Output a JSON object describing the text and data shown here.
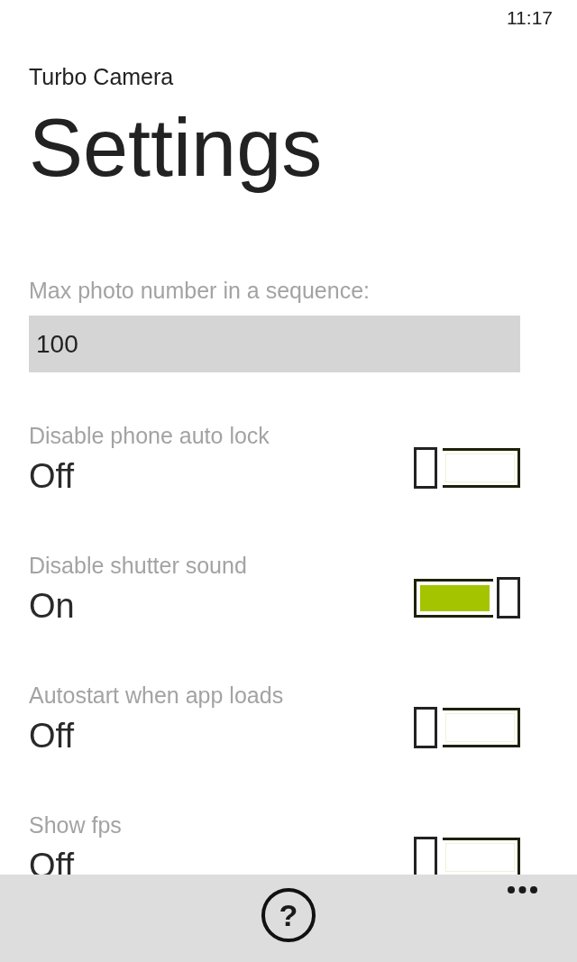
{
  "status_bar": {
    "time": "11:17"
  },
  "header": {
    "app_title": "Turbo Camera",
    "page_title": "Settings"
  },
  "sequence_field": {
    "label": "Max photo number in a sequence:",
    "value": "100"
  },
  "toggles": [
    {
      "label": "Disable phone auto lock",
      "value": "Off",
      "on": false
    },
    {
      "label": "Disable shutter sound",
      "value": "On",
      "on": true
    },
    {
      "label": "Autostart when app loads",
      "value": "Off",
      "on": false
    },
    {
      "label": "Show fps",
      "value": "Off",
      "on": false
    }
  ],
  "app_bar": {
    "buttons": [
      {
        "kind": "help",
        "glyph": "?"
      }
    ]
  }
}
